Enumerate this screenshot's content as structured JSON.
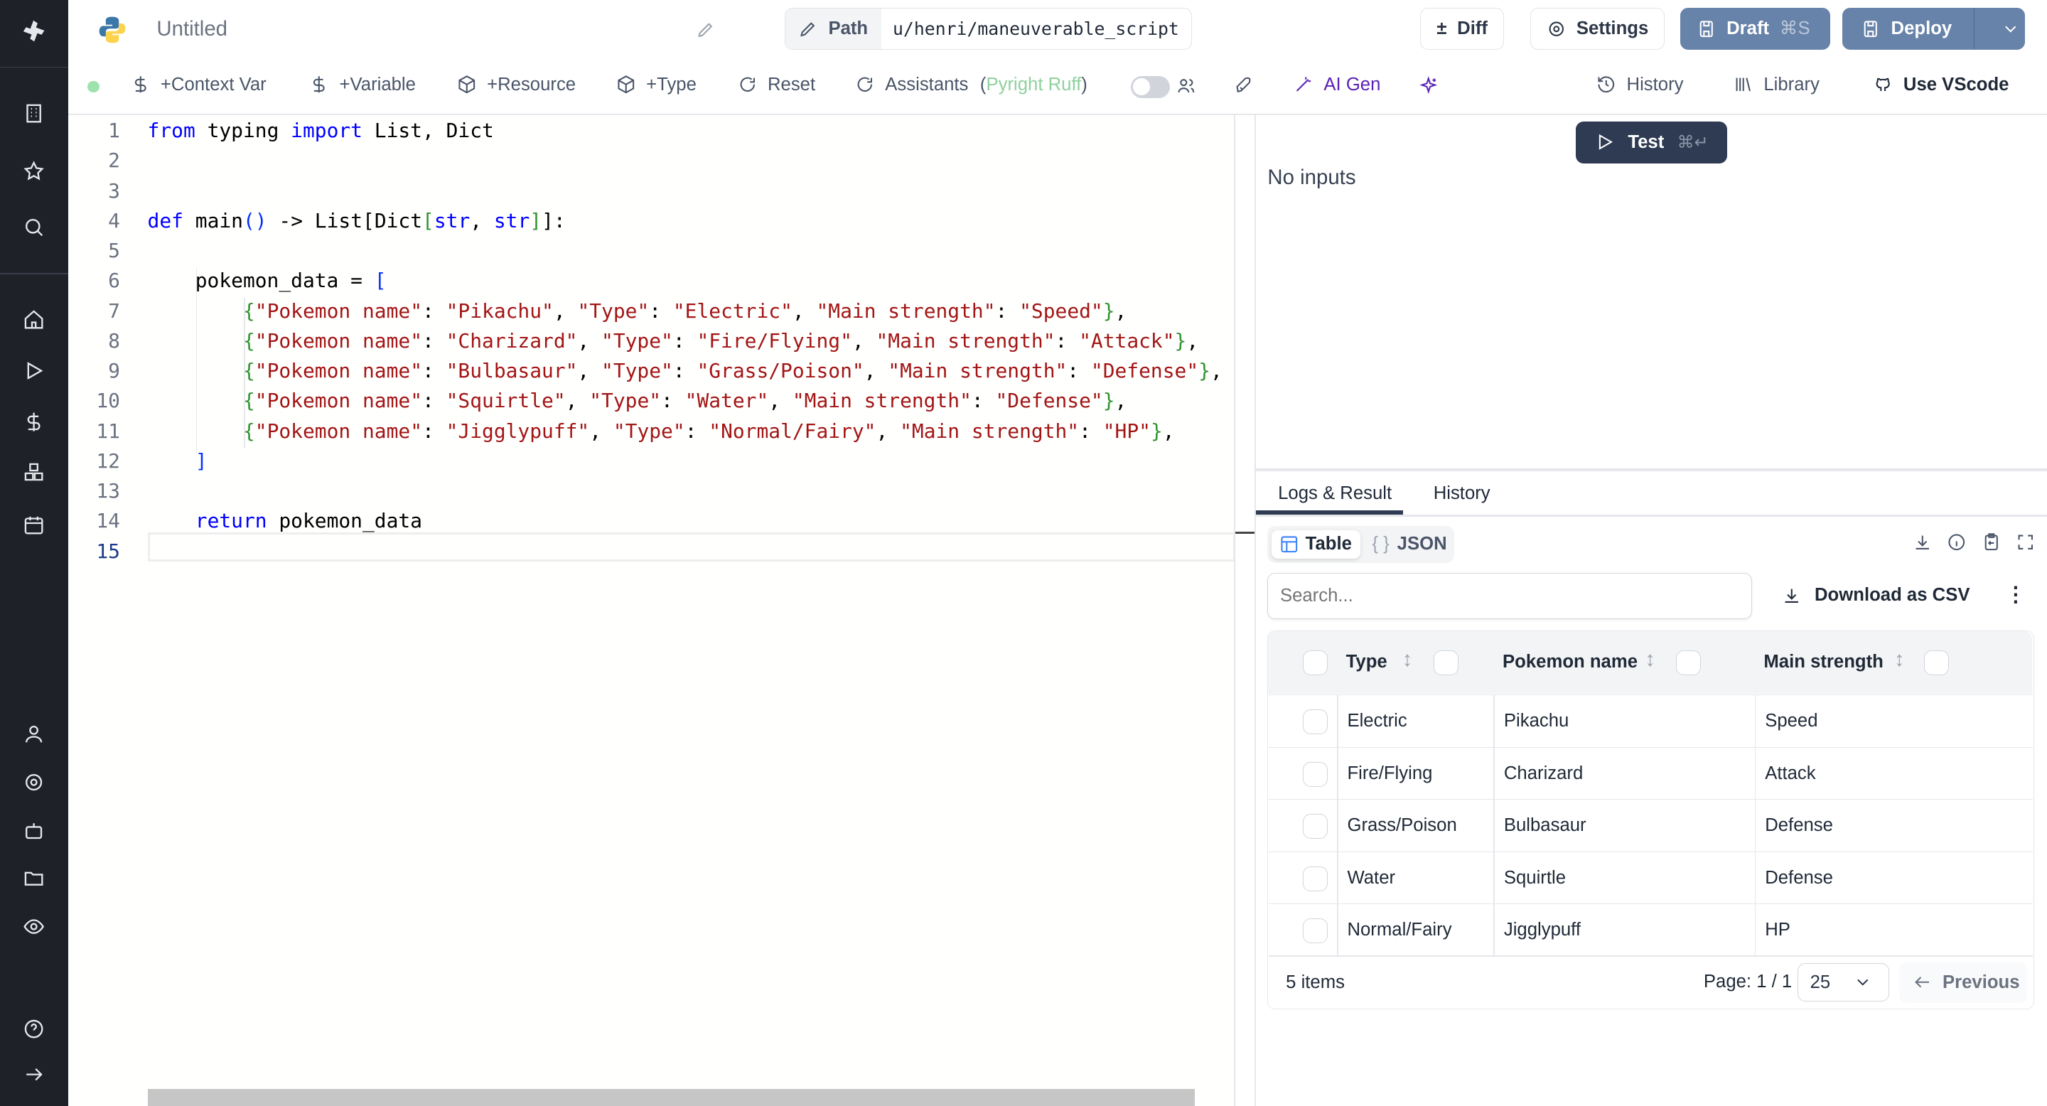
{
  "header": {
    "title": "Untitled",
    "path_label": "Path",
    "path_value": "u/henri/maneuverable_script",
    "diff": "Diff",
    "settings": "Settings",
    "draft": "Draft",
    "draft_shortcut": "⌘S",
    "deploy": "Deploy"
  },
  "toolbar": {
    "context_var": "+Context Var",
    "variable": "+Variable",
    "resource": "+Resource",
    "type": "+Type",
    "reset": "Reset",
    "assistants": "Assistants",
    "assistants_detail_open": "(",
    "assistants_detail": "Pyright Ruff",
    "assistants_detail_close": ")",
    "ai_gen": "AI Gen",
    "history": "History",
    "library": "Library",
    "use_vscode": "Use VScode",
    "status_color": "#9ee2ad",
    "ai_color": "#5b21b6"
  },
  "editor": {
    "current_line": 15,
    "lines": [
      [
        [
          "from ",
          "kw"
        ],
        [
          "typing ",
          "pl"
        ],
        [
          "import ",
          "kw"
        ],
        [
          "List, Dict",
          "pl"
        ]
      ],
      [],
      [],
      [
        [
          "def ",
          "kw"
        ],
        [
          "main",
          "pl"
        ],
        [
          "()",
          "bb"
        ],
        [
          " -> List",
          "pl"
        ],
        [
          "[",
          "pl"
        ],
        [
          "Dict",
          "pl"
        ],
        [
          "[",
          "br"
        ],
        [
          "str",
          "kw"
        ],
        [
          ", ",
          "pl"
        ],
        [
          "str",
          "kw"
        ],
        [
          "]",
          "br"
        ],
        [
          "]",
          "pl"
        ],
        [
          ":",
          "pl"
        ]
      ],
      [],
      [
        [
          "    pokemon_data = ",
          "pl"
        ],
        [
          "[",
          "bb"
        ]
      ],
      [
        [
          "        ",
          "pl"
        ],
        [
          "{",
          "br"
        ],
        [
          "\"Pokemon name\"",
          "st"
        ],
        [
          ": ",
          "pl"
        ],
        [
          "\"Pikachu\"",
          "st"
        ],
        [
          ", ",
          "pl"
        ],
        [
          "\"Type\"",
          "st"
        ],
        [
          ": ",
          "pl"
        ],
        [
          "\"Electric\"",
          "st"
        ],
        [
          ", ",
          "pl"
        ],
        [
          "\"Main strength\"",
          "st"
        ],
        [
          ": ",
          "pl"
        ],
        [
          "\"Speed\"",
          "st"
        ],
        [
          "}",
          "br"
        ],
        [
          ",",
          "pl"
        ]
      ],
      [
        [
          "        ",
          "pl"
        ],
        [
          "{",
          "br"
        ],
        [
          "\"Pokemon name\"",
          "st"
        ],
        [
          ": ",
          "pl"
        ],
        [
          "\"Charizard\"",
          "st"
        ],
        [
          ", ",
          "pl"
        ],
        [
          "\"Type\"",
          "st"
        ],
        [
          ": ",
          "pl"
        ],
        [
          "\"Fire/Flying\"",
          "st"
        ],
        [
          ", ",
          "pl"
        ],
        [
          "\"Main strength\"",
          "st"
        ],
        [
          ": ",
          "pl"
        ],
        [
          "\"Attack\"",
          "st"
        ],
        [
          "}",
          "br"
        ],
        [
          ",",
          "pl"
        ]
      ],
      [
        [
          "        ",
          "pl"
        ],
        [
          "{",
          "br"
        ],
        [
          "\"Pokemon name\"",
          "st"
        ],
        [
          ": ",
          "pl"
        ],
        [
          "\"Bulbasaur\"",
          "st"
        ],
        [
          ", ",
          "pl"
        ],
        [
          "\"Type\"",
          "st"
        ],
        [
          ": ",
          "pl"
        ],
        [
          "\"Grass/Poison\"",
          "st"
        ],
        [
          ", ",
          "pl"
        ],
        [
          "\"Main strength\"",
          "st"
        ],
        [
          ": ",
          "pl"
        ],
        [
          "\"Defense\"",
          "st"
        ],
        [
          "}",
          "br"
        ],
        [
          ",",
          "pl"
        ]
      ],
      [
        [
          "        ",
          "pl"
        ],
        [
          "{",
          "br"
        ],
        [
          "\"Pokemon name\"",
          "st"
        ],
        [
          ": ",
          "pl"
        ],
        [
          "\"Squirtle\"",
          "st"
        ],
        [
          ", ",
          "pl"
        ],
        [
          "\"Type\"",
          "st"
        ],
        [
          ": ",
          "pl"
        ],
        [
          "\"Water\"",
          "st"
        ],
        [
          ", ",
          "pl"
        ],
        [
          "\"Main strength\"",
          "st"
        ],
        [
          ": ",
          "pl"
        ],
        [
          "\"Defense\"",
          "st"
        ],
        [
          "}",
          "br"
        ],
        [
          ",",
          "pl"
        ]
      ],
      [
        [
          "        ",
          "pl"
        ],
        [
          "{",
          "br"
        ],
        [
          "\"Pokemon name\"",
          "st"
        ],
        [
          ": ",
          "pl"
        ],
        [
          "\"Jigglypuff\"",
          "st"
        ],
        [
          ", ",
          "pl"
        ],
        [
          "\"Type\"",
          "st"
        ],
        [
          ": ",
          "pl"
        ],
        [
          "\"Normal/Fairy\"",
          "st"
        ],
        [
          ", ",
          "pl"
        ],
        [
          "\"Main strength\"",
          "st"
        ],
        [
          ": ",
          "pl"
        ],
        [
          "\"HP\"",
          "st"
        ],
        [
          "}",
          "br"
        ],
        [
          ",",
          "pl"
        ]
      ],
      [
        [
          "    ",
          "pl"
        ],
        [
          "]",
          "bb"
        ]
      ],
      [],
      [
        [
          "    ",
          "pl"
        ],
        [
          "return ",
          "kw"
        ],
        [
          "pokemon_data",
          "pl"
        ]
      ],
      []
    ]
  },
  "right": {
    "test": "Test",
    "test_shortcut": "⌘↵",
    "no_inputs": "No inputs",
    "tabs": [
      "Logs & Result",
      "History"
    ],
    "view_table": "Table",
    "view_json": "JSON",
    "search_placeholder": "Search...",
    "download_csv": "Download as CSV",
    "columns": [
      "Type",
      "Pokemon name",
      "Main strength"
    ],
    "rows": [
      [
        "Electric",
        "Pikachu",
        "Speed"
      ],
      [
        "Fire/Flying",
        "Charizard",
        "Attack"
      ],
      [
        "Grass/Poison",
        "Bulbasaur",
        "Defense"
      ],
      [
        "Water",
        "Squirtle",
        "Defense"
      ],
      [
        "Normal/Fairy",
        "Jigglypuff",
        "HP"
      ]
    ],
    "items": "5 items",
    "page": "Page: 1 / 1",
    "page_size": "25",
    "previous": "Previous"
  }
}
